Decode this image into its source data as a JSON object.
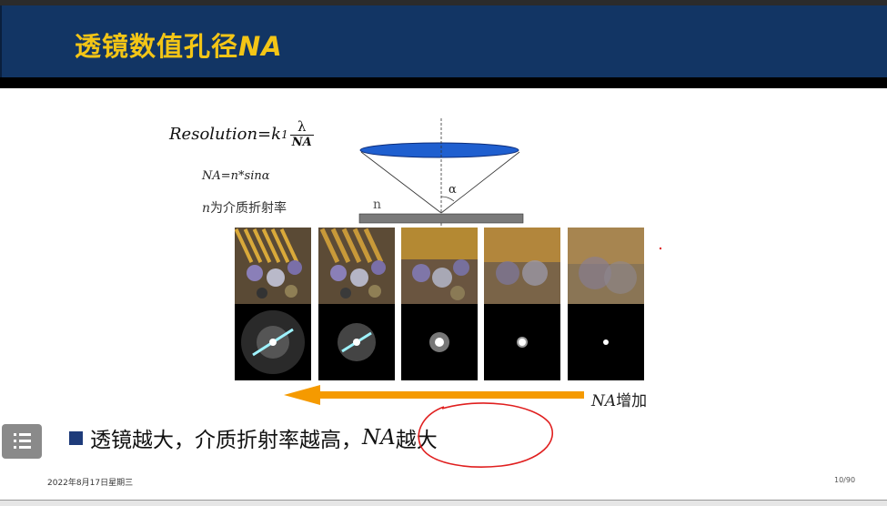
{
  "slide": {
    "title_prefix": "透镜数值孔径",
    "title_na": "NA",
    "formula_lhs": "Resolution=",
    "formula_k": "k",
    "formula_k_sub": "1",
    "formula_num": "λ",
    "formula_den": "NA",
    "na_def": "NA=n*sinα",
    "n_note_var": "n",
    "n_note_text": "为介质折射率",
    "diagram_n": "n",
    "diagram_alpha": "α",
    "na_increase_var": "NA",
    "na_increase_text": "增加",
    "bullet_text": "透镜越大，介质折射率越高，",
    "bullet_na": "NA",
    "bullet_suffix": "越大",
    "footer_date": "2022年8月17日星期三",
    "footer_page": "10/90",
    "menu_icon": "list-icon",
    "colors": {
      "header_bg": "#123564",
      "title": "#f3c516",
      "arrow": "#f59a00",
      "lens": "#1f5fcf",
      "circle": "#e01f1f"
    }
  }
}
